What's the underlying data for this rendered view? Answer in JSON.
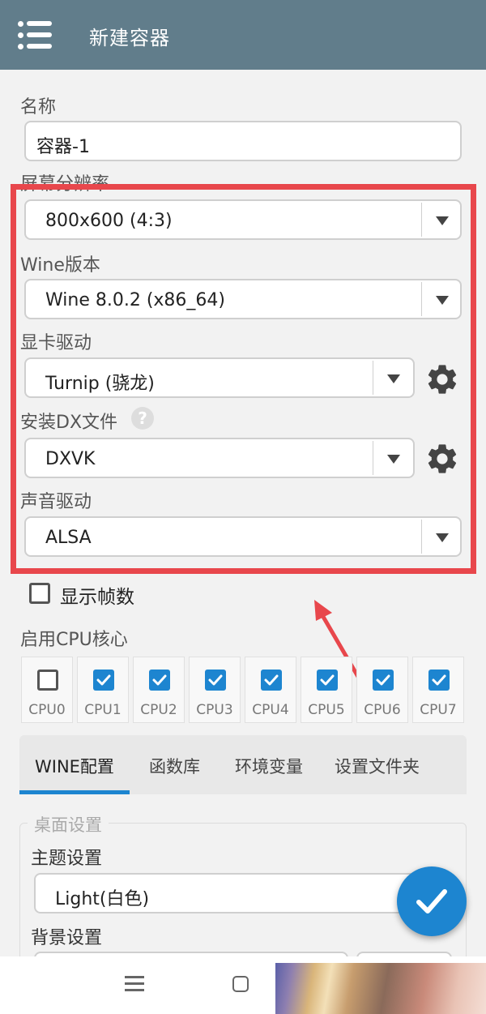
{
  "app_bar": {
    "title": "新建容器",
    "menu_icon": "menu-icon"
  },
  "form": {
    "name": {
      "label": "名称",
      "value": "容器-1"
    },
    "resolution": {
      "label": "屏幕分辨率",
      "value": "800x600 (4:3)"
    },
    "wine_version": {
      "label": "Wine版本",
      "value": "Wine 8.0.2 (x86_64)"
    },
    "graphics_driver": {
      "label": "显卡驱动",
      "value": "Turnip (骁龙)",
      "settings_icon": "gear-icon"
    },
    "dx_wrapper": {
      "label": "安装DX文件",
      "value": "DXVK",
      "help_icon": "help-icon",
      "settings_icon": "gear-icon"
    },
    "audio_driver": {
      "label": "声音驱动",
      "value": "ALSA"
    }
  },
  "show_fps": {
    "label": "显示帧数",
    "checked": false
  },
  "cpu_cores": {
    "label": "启用CPU核心",
    "cores": [
      {
        "name": "CPU0",
        "checked": false
      },
      {
        "name": "CPU1",
        "checked": true
      },
      {
        "name": "CPU2",
        "checked": true
      },
      {
        "name": "CPU3",
        "checked": true
      },
      {
        "name": "CPU4",
        "checked": true
      },
      {
        "name": "CPU5",
        "checked": true
      },
      {
        "name": "CPU6",
        "checked": true
      },
      {
        "name": "CPU7",
        "checked": true
      }
    ]
  },
  "tabs": [
    {
      "label": "WINE配置",
      "active": true
    },
    {
      "label": "函数库",
      "active": false
    },
    {
      "label": "环境变量",
      "active": false
    },
    {
      "label": "设置文件夹",
      "active": false
    }
  ],
  "desktop_settings": {
    "title": "桌面设置",
    "theme": {
      "label": "主题设置",
      "value": "Light(白色)"
    },
    "background": {
      "label": "背景设置"
    }
  },
  "fab": {
    "icon": "check-icon"
  },
  "colors": {
    "app_bar": "#617d8b",
    "accent": "#1d85d0",
    "annotation": "#e8474c",
    "background": "#f2f2f2"
  }
}
